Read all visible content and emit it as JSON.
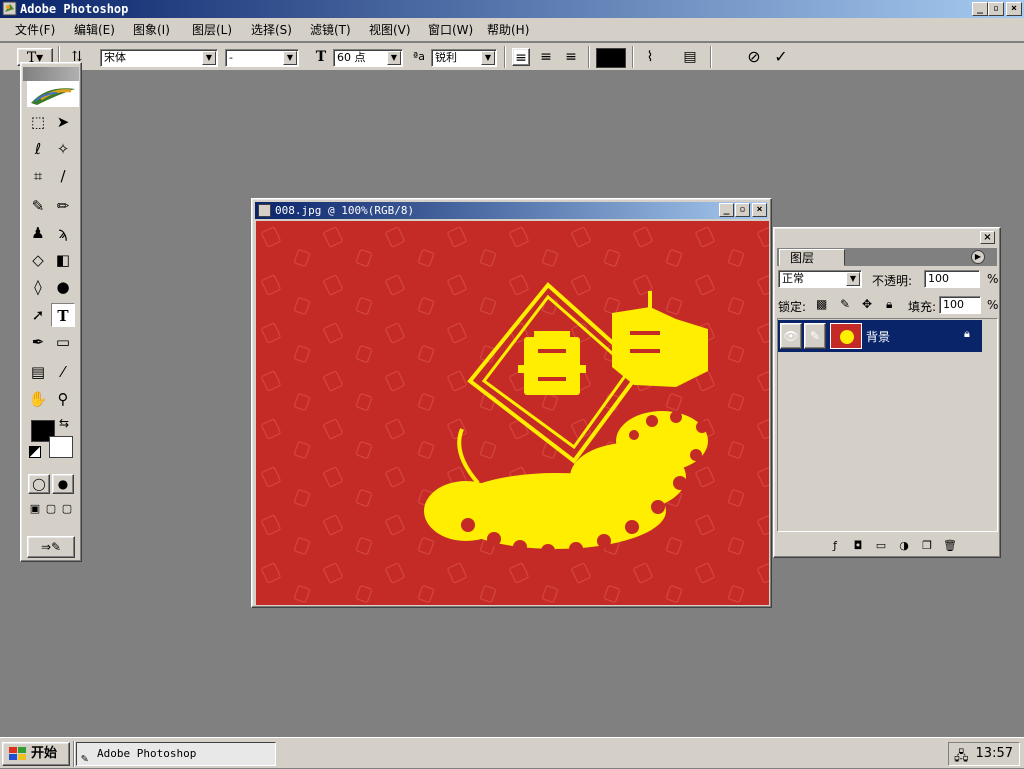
{
  "app": {
    "title": "Adobe Photoshop"
  },
  "window_controls": {
    "minimize": "_",
    "restore": "▫",
    "close": "×"
  },
  "menubar": [
    "文件(F)",
    "编辑(E)",
    "图象(I)",
    "图层(L)",
    "选择(S)",
    "滤镜(T)",
    "视图(V)",
    "窗口(W)",
    "帮助(H)"
  ],
  "options": {
    "font_family": "宋体",
    "font_style": "-",
    "font_size": "60 点",
    "antialias": "锐利",
    "text_color": "#000000",
    "cancel_icon": "⊘",
    "commit_icon": "✓"
  },
  "document": {
    "title": "008.jpg @ 100%(RGB/8)",
    "background_color": "#c42b26",
    "art_color": "#ffee00"
  },
  "layers": {
    "tab": "图层",
    "blend_mode": "正常",
    "opacity_label": "不透明:",
    "opacity": "100",
    "fill_label": "填充:",
    "fill": "100",
    "percent": "%",
    "lock_label": "锁定:",
    "layer_name": "背景"
  },
  "taskbar": {
    "start": "开始",
    "app": "Adobe Photoshop",
    "clock": "13:57"
  }
}
